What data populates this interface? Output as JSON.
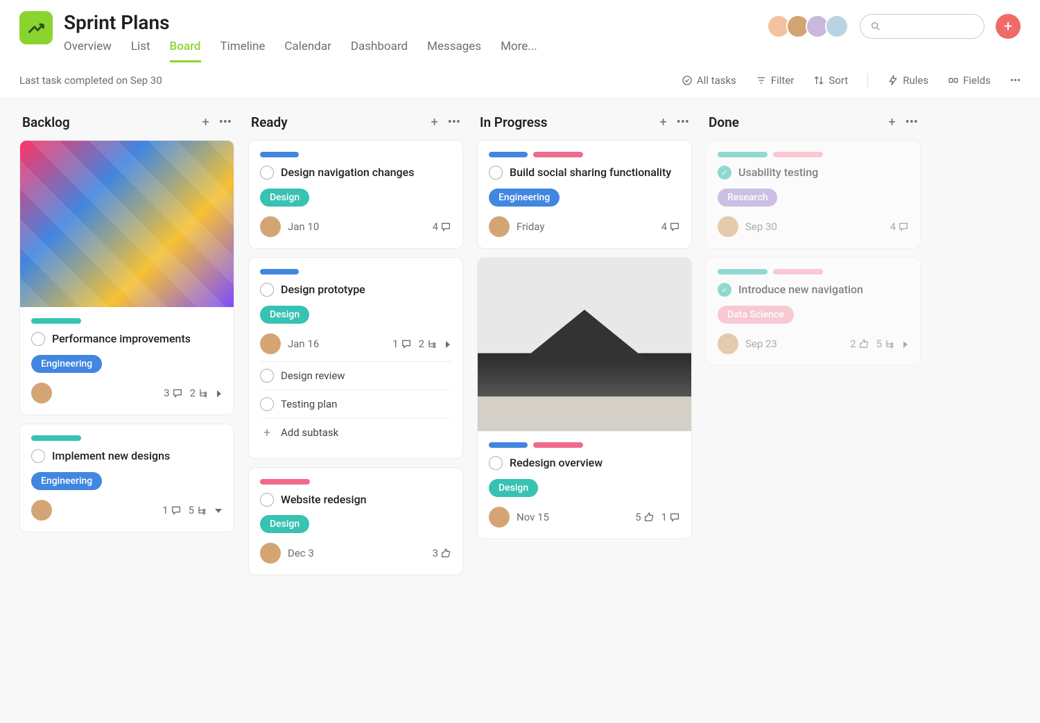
{
  "project": {
    "title": "Sprint Plans"
  },
  "tabs": [
    "Overview",
    "List",
    "Board",
    "Timeline",
    "Calendar",
    "Dashboard",
    "Messages",
    "More..."
  ],
  "active_tab": "Board",
  "status_line": "Last task completed on Sep 30",
  "toolbar": {
    "all_tasks": "All tasks",
    "filter": "Filter",
    "sort": "Sort",
    "rules": "Rules",
    "fields": "Fields"
  },
  "columns": [
    {
      "title": "Backlog",
      "cards": [
        {
          "pills": [
            "teal"
          ],
          "title": "Performance improvements",
          "tag": "Engineering",
          "tag_type": "eng",
          "date": "",
          "comments": 3,
          "subtasks_count": 2,
          "has_image": true,
          "image_type": "hero",
          "show_chevron": true
        },
        {
          "pills": [
            "teal"
          ],
          "title": "Implement new designs",
          "tag": "Engineering",
          "tag_type": "eng",
          "date": "",
          "comments": 1,
          "subtasks_count": 5,
          "show_caret": true
        }
      ]
    },
    {
      "title": "Ready",
      "cards": [
        {
          "pills": [
            "blue"
          ],
          "title": "Design navigation changes",
          "tag": "Design",
          "tag_type": "des",
          "date": "Jan 10",
          "comments": 4
        },
        {
          "pills": [
            "blue"
          ],
          "title": "Design prototype",
          "tag": "Design",
          "tag_type": "des",
          "date": "Jan 16",
          "comments": 1,
          "subtasks_count": 2,
          "show_chevron": true,
          "subtasks": [
            "Design review",
            "Testing plan"
          ],
          "add_subtask": "Add subtask"
        },
        {
          "pills": [
            "pink"
          ],
          "title": "Website redesign",
          "tag": "Design",
          "tag_type": "des",
          "date": "Dec 3",
          "likes": 3
        }
      ]
    },
    {
      "title": "In Progress",
      "cards": [
        {
          "pills": [
            "blue",
            "pink"
          ],
          "title": "Build social sharing functionality",
          "tag": "Engineering",
          "tag_type": "eng",
          "date": "Friday",
          "comments": 4
        },
        {
          "pills": [
            "blue",
            "pink"
          ],
          "title": "Redesign overview",
          "tag": "Design",
          "tag_type": "des",
          "date": "Nov 15",
          "likes": 5,
          "comments": 1,
          "has_image": true,
          "image_type": "mtn"
        }
      ]
    },
    {
      "title": "Done",
      "cards": [
        {
          "done": true,
          "pills": [
            "teal",
            "lpink"
          ],
          "title": "Usability testing",
          "tag": "Research",
          "tag_type": "res",
          "date": "Sep 30",
          "comments": 4
        },
        {
          "done": true,
          "pills": [
            "teal",
            "lpink"
          ],
          "title": "Introduce new navigation",
          "tag": "Data Science",
          "tag_type": "ds",
          "date": "Sep 23",
          "likes": 2,
          "subtasks_count": 5,
          "show_chevron": true
        }
      ]
    }
  ]
}
